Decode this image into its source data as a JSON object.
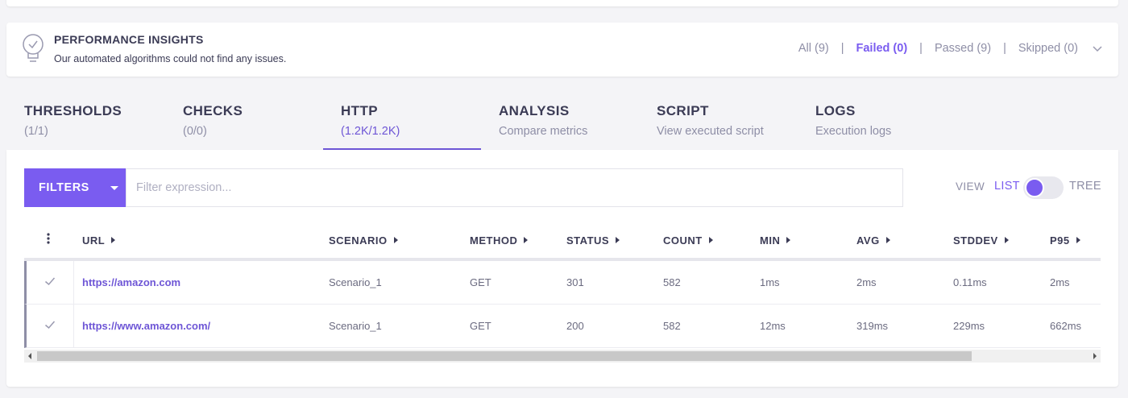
{
  "insights": {
    "title": "PERFORMANCE INSIGHTS",
    "subtitle": "Our automated algorithms could not find any issues.",
    "filters": [
      "All (9)",
      "Failed (0)",
      "Passed (9)",
      "Skipped (0)"
    ],
    "active_filter": "Failed (0)",
    "separator": "|"
  },
  "tabs": [
    {
      "title": "THRESHOLDS",
      "sub": "(1/1)"
    },
    {
      "title": "CHECKS",
      "sub": "(0/0)"
    },
    {
      "title": "HTTP",
      "sub": "(1.2K/1.2K)"
    },
    {
      "title": "ANALYSIS",
      "sub": "Compare metrics"
    },
    {
      "title": "SCRIPT",
      "sub": "View executed script"
    },
    {
      "title": "LOGS",
      "sub": "Execution logs"
    }
  ],
  "active_tab": "HTTP",
  "toolbar": {
    "filters_label": "FILTERS",
    "filter_placeholder": "Filter expression...",
    "view_label": "VIEW",
    "list_label": "LIST",
    "tree_label": "TREE"
  },
  "table": {
    "columns": [
      "URL",
      "SCENARIO",
      "METHOD",
      "STATUS",
      "COUNT",
      "MIN",
      "AVG",
      "STDDEV",
      "P95"
    ],
    "rows": [
      [
        "https://amazon.com",
        "Scenario_1",
        "GET",
        "301",
        "582",
        "1ms",
        "2ms",
        "0.11ms",
        "2ms"
      ],
      [
        "https://www.amazon.com/",
        "Scenario_1",
        "GET",
        "200",
        "582",
        "12ms",
        "319ms",
        "229ms",
        "662ms"
      ]
    ]
  },
  "colors": {
    "accent": "#7a5cf0",
    "text": "#3b3b55",
    "muted": "#8e8ea6"
  }
}
